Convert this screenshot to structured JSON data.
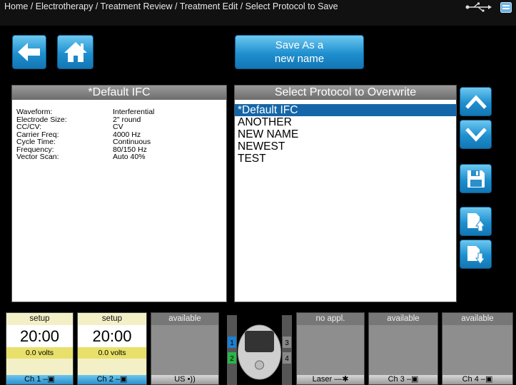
{
  "breadcrumb": "Home / Electrotherapy / Treatment Review / Treatment Edit / Select Protocol to Save",
  "status_icons": [
    "usb-icon",
    "drive-icon"
  ],
  "toolbar": {
    "back_icon": "arrow-left-icon",
    "home_icon": "home-icon",
    "save_as_line1": "Save As a",
    "save_as_line2": "new name"
  },
  "left_panel": {
    "title": "*Default IFC",
    "details": [
      {
        "label": "Waveform:",
        "value": "Interferential"
      },
      {
        "label": "Electrode Size:",
        "value": "2\" round"
      },
      {
        "label": "CC/CV:",
        "value": "CV"
      },
      {
        "label": "Carrier Freq:",
        "value": "4000 Hz"
      },
      {
        "label": "Cycle Time:",
        "value": "Continuous"
      },
      {
        "label": "Frequency:",
        "value": "80/150 Hz"
      },
      {
        "label": "Vector Scan:",
        "value": "Auto 40%"
      }
    ]
  },
  "right_panel": {
    "title": "Select Protocol to Overwrite",
    "protocols": [
      "*Default IFC",
      "ANOTHER",
      "NEW NAME",
      "NEWEST",
      "TEST"
    ],
    "selected_index": 0
  },
  "side_buttons": [
    "chevron-up-icon",
    "chevron-down-icon",
    "save-disk-icon",
    "export-up-icon",
    "import-down-icon"
  ],
  "channels": [
    {
      "status": "setup",
      "time": "20:00",
      "volts": "0.0 volts",
      "label": "Ch 1"
    },
    {
      "status": "setup",
      "time": "20:00",
      "volts": "0.0 volts",
      "label": "Ch 2"
    },
    {
      "status": "available",
      "label": "US"
    },
    {
      "status": "no appl.",
      "label": "Laser"
    },
    {
      "status": "available",
      "label": "Ch 3"
    },
    {
      "status": "available",
      "label": "Ch 4"
    }
  ],
  "device_ports": {
    "left": [
      "1",
      "2"
    ],
    "right": [
      "3",
      "4"
    ]
  },
  "colors": {
    "accent": "#1f8fcf",
    "selection": "#1466a8",
    "active_card": "#f3f0c8",
    "volts_bar": "#e8e06a"
  }
}
